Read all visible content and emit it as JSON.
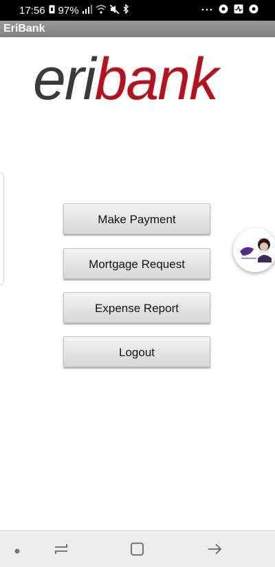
{
  "status_bar": {
    "time": "17:56",
    "battery": "97%",
    "left_icons": [
      "sim-icon",
      "signal-icon",
      "wifi-icon",
      "mute-icon",
      "bluetooth-icon"
    ],
    "right_icons": [
      "more-icon",
      "chrome-icon",
      "activity-icon",
      "chrome-icon"
    ]
  },
  "app": {
    "title": "EriBank",
    "logo_text_left": "eri",
    "logo_text_right": "bank",
    "logo_colors": {
      "eri": "#3a3a3a",
      "bank": "#b5121b"
    }
  },
  "menu": {
    "buttons": [
      {
        "label": "Make Payment"
      },
      {
        "label": "Mortgage Request"
      },
      {
        "label": "Expense Report"
      },
      {
        "label": "Logout"
      }
    ]
  },
  "floating_bubble": {
    "icon": "avatar-bubble-icon"
  },
  "nav_bar": {
    "items": [
      "dot-icon",
      "recent-apps-icon",
      "home-icon",
      "back-icon"
    ]
  }
}
